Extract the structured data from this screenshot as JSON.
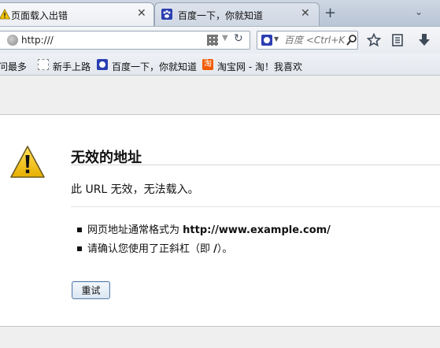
{
  "tabs": [
    {
      "title": "页面载入出错",
      "active": true,
      "icon": "warning-icon"
    },
    {
      "title": "百度一下，你就知道",
      "active": false,
      "icon": "baidu-paw-icon"
    }
  ],
  "tab_close_glyph": "✕",
  "new_tab_glyph": "+",
  "tab_list_glyph": "⌄",
  "navbar": {
    "url": "http:///",
    "search_placeholder": "百度 <Ctrl+K>",
    "icons": [
      "globe-icon",
      "qr-code-icon",
      "dropdown-arrow-icon",
      "reload-icon",
      "search-go-icon",
      "star-bookmark-icon",
      "reading-list-icon",
      "download-icon"
    ]
  },
  "bookmarks": [
    {
      "label": "访问最多",
      "icon": "none"
    },
    {
      "label": "新手上路",
      "icon": "page-icon"
    },
    {
      "label": "百度一下，你就知道",
      "icon": "baidu-paw-icon"
    },
    {
      "label": "淘宝网 - 淘！我喜欢",
      "icon": "taobao-icon"
    }
  ],
  "error": {
    "title": "无效的地址",
    "description": "此 URL 无效，无法载入。",
    "hint1_prefix": "网页地址通常格式为 ",
    "hint1_example": "http://www.example.com/",
    "hint2_prefix": "请确认您使用了正斜杠（即 ",
    "hint2_slash": "/",
    "hint2_suffix": "）。",
    "retry_label": "重试"
  },
  "colors": {
    "tabstrip": "#c4cedb",
    "warning_yellow": "#f2c300",
    "baidu_blue": "#2a3eb1",
    "taobao_orange": "#f25a00"
  }
}
